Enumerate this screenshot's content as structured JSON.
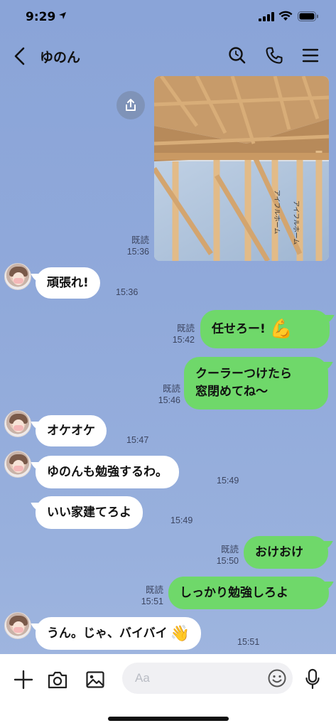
{
  "status_bar": {
    "time": "9:29"
  },
  "header": {
    "contact_name": "ゆのん"
  },
  "messages": [
    {
      "side": "out",
      "kind": "image",
      "read": "既読",
      "time": "15:36",
      "image_text": "アイフルホーム"
    },
    {
      "side": "in",
      "text": "頑張れ!",
      "time": "15:36"
    },
    {
      "side": "out",
      "text": "任せろー!",
      "emoji": "💪",
      "read": "既読",
      "time": "15:42"
    },
    {
      "side": "out",
      "lines": [
        "クーラーつけたら",
        "窓閉めてね〜"
      ],
      "read": "既読",
      "time": "15:46"
    },
    {
      "side": "in",
      "text": "オケオケ",
      "time": "15:47"
    },
    {
      "side": "in",
      "text": "ゆのんも勉強するわ。",
      "time": "15:49"
    },
    {
      "side": "in",
      "text": "いい家建てろよ",
      "time": "15:49"
    },
    {
      "side": "out",
      "text": "おけおけ",
      "read": "既読",
      "time": "15:50"
    },
    {
      "side": "out",
      "text": "しっかり勉強しろよ",
      "read": "既読",
      "time": "15:51"
    },
    {
      "side": "in",
      "text": "うん。じゃ、バイバイ",
      "emoji": "👋",
      "time": "15:51"
    }
  ],
  "input": {
    "placeholder": "Aa"
  },
  "icons": {
    "header": [
      "chevron-left-icon",
      "search-icon",
      "phone-icon",
      "menu-icon"
    ],
    "input_bar": [
      "plus-icon",
      "camera-icon",
      "image-icon",
      "emoji-icon",
      "mic-icon"
    ]
  },
  "colors": {
    "background": "#8ea7d8",
    "outgoing_bubble": "#6fd86a",
    "incoming_bubble": "#ffffff"
  }
}
